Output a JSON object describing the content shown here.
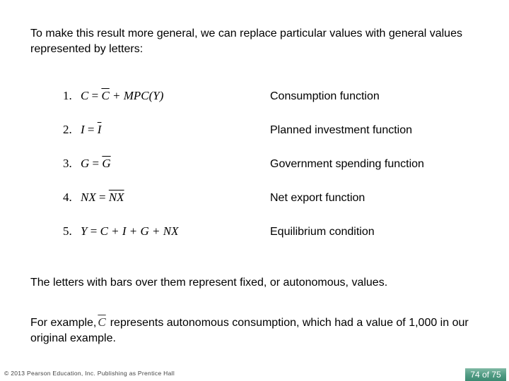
{
  "intro": "To make this result more general, we can replace particular values with general values represented by letters:",
  "equations": [
    {
      "num": "1.",
      "lhs": "C",
      "eq": "=",
      "rhs_bar": "C",
      "rhs_rest": "+ MPC(Y)",
      "description": "Consumption function"
    },
    {
      "num": "2.",
      "lhs": "I",
      "eq": "=",
      "rhs_bar": "I",
      "rhs_rest": "",
      "description": "Planned investment function"
    },
    {
      "num": "3.",
      "lhs": "G",
      "eq": "=",
      "rhs_bar": "G",
      "rhs_rest": "",
      "description": "Government spending function"
    },
    {
      "num": "4.",
      "lhs": "NX",
      "eq": "=",
      "rhs_bar": "NX",
      "rhs_rest": "",
      "description": "Net export function"
    },
    {
      "num": "5.",
      "lhs": "Y",
      "eq": "=",
      "rhs_bar": "",
      "rhs_rest": "C + I + G + NX",
      "description": "Equilibrium condition"
    }
  ],
  "note1": "The letters with bars over them represent fixed, or autonomous, values.",
  "note2": {
    "prefix": "For example,",
    "symbol": "C",
    "suffix": "represents autonomous consumption, which had a value of 1,000 in our original example."
  },
  "footer": "© 2013 Pearson Education, Inc. Publishing as Prentice Hall",
  "page": "74 of 75"
}
